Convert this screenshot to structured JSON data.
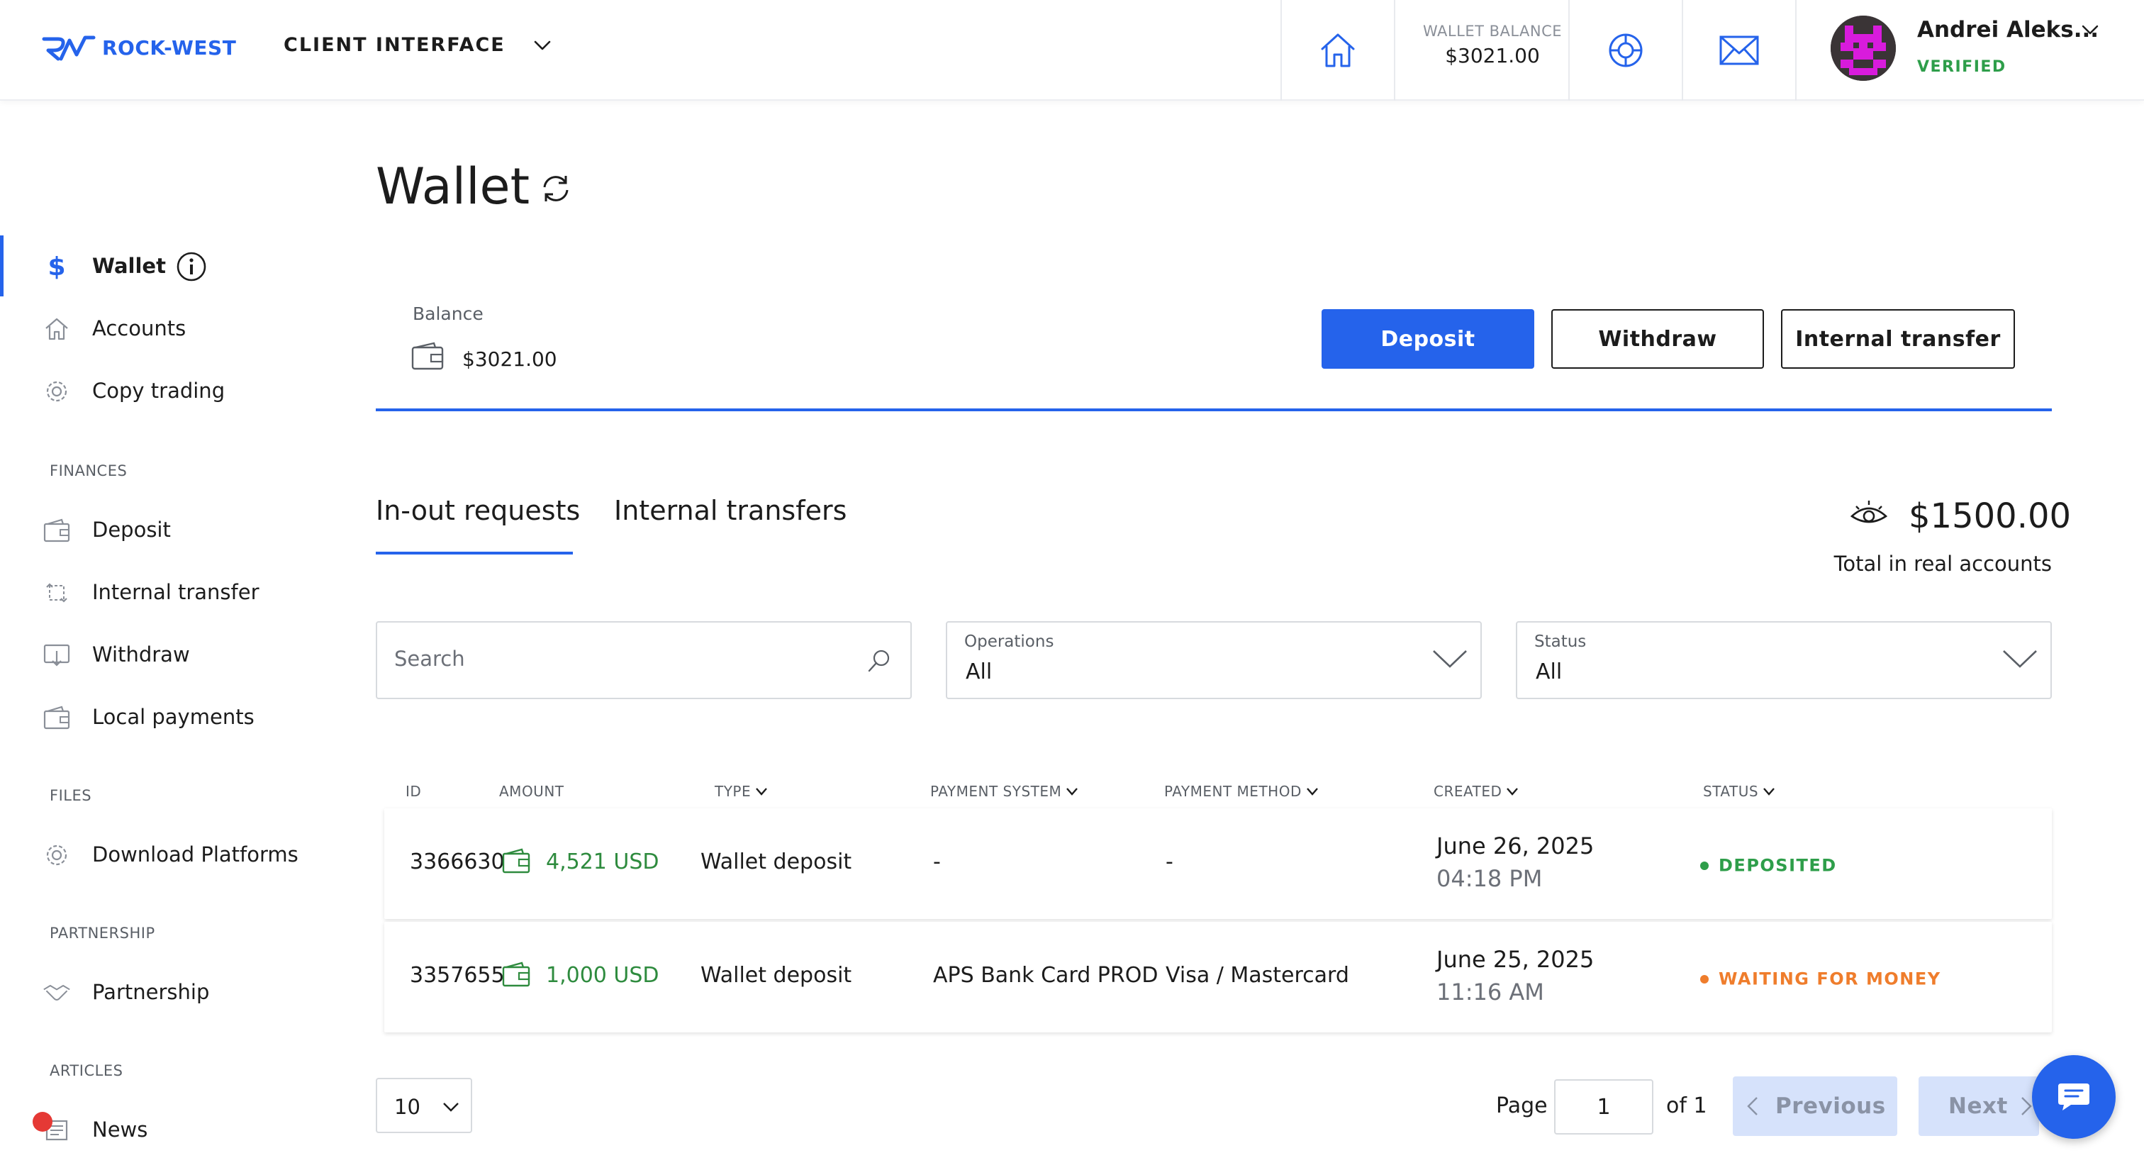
{
  "header": {
    "logo_text": "ROCK-WEST",
    "client_interface": "CLIENT INTERFACE",
    "wallet_balance_label": "WALLET BALANCE",
    "wallet_balance_value": "$3021.00",
    "user_name": "Andrei Aleks...",
    "user_status": "VERIFIED",
    "icons": [
      "home-icon",
      "support-icon",
      "mail-icon"
    ]
  },
  "sidebar": {
    "main": [
      {
        "label": "Wallet",
        "icon": "dollar-icon",
        "active": true
      },
      {
        "label": "Accounts",
        "icon": "home-icon"
      },
      {
        "label": "Copy trading",
        "icon": "gear-icon"
      }
    ],
    "finances_title": "FINANCES",
    "finances": [
      {
        "label": "Deposit",
        "icon": "wallet-icon"
      },
      {
        "label": "Internal transfer",
        "icon": "transfer-icon"
      },
      {
        "label": "Withdraw",
        "icon": "withdraw-icon"
      },
      {
        "label": "Local payments",
        "icon": "wallet-icon"
      }
    ],
    "files_title": "FILES",
    "files": [
      {
        "label": "Download Platforms",
        "icon": "gear-icon"
      }
    ],
    "partnership_title": "PARTNERSHIP",
    "partnership": [
      {
        "label": "Partnership",
        "icon": "handshake-icon"
      }
    ],
    "articles_title": "ARTICLES",
    "articles": [
      {
        "label": "News",
        "icon": "news-icon"
      }
    ]
  },
  "main": {
    "title": "Wallet",
    "balance_label": "Balance",
    "balance_value": "$3021.00",
    "buttons": {
      "deposit": "Deposit",
      "withdraw": "Withdraw",
      "internal": "Internal transfer"
    },
    "tabs": [
      {
        "label": "In-out requests",
        "active": true
      },
      {
        "label": "Internal transfers",
        "active": false
      }
    ],
    "total_value": "$1500.00",
    "total_label": "Total in real accounts",
    "search_placeholder": "Search",
    "operations_label": "Operations",
    "operations_value": "All",
    "status_label": "Status",
    "status_value": "All"
  },
  "table": {
    "columns": {
      "id": "ID",
      "amount": "AMOUNT",
      "type": "TYPE",
      "payment_system": "PAYMENT SYSTEM",
      "payment_method": "PAYMENT METHOD",
      "created": "CREATED",
      "status": "STATUS"
    },
    "rows": [
      {
        "id": "3366630",
        "amount": "4,521 USD",
        "type": "Wallet deposit",
        "payment_system": "-",
        "payment_method": "-",
        "date": "June 26, 2025",
        "time": "04:18 PM",
        "status": "DEPOSITED",
        "status_color": "#2e9e4a"
      },
      {
        "id": "3357655",
        "amount": "1,000 USD",
        "type": "Wallet deposit",
        "payment_system": "APS Bank Card PROD",
        "payment_method": "Visa / Mastercard",
        "date": "June 25, 2025",
        "time": "11:16 AM",
        "status": "WAITING FOR MONEY",
        "status_color": "#ef7d2c"
      }
    ]
  },
  "pagination": {
    "per_page": "10",
    "page_label": "Page",
    "page_value": "1",
    "of_label": "of 1",
    "previous": "Previous",
    "next": "Next"
  },
  "colors": {
    "accent": "#2563eb",
    "success": "#2e9e4a",
    "warning": "#ef7d2c"
  }
}
